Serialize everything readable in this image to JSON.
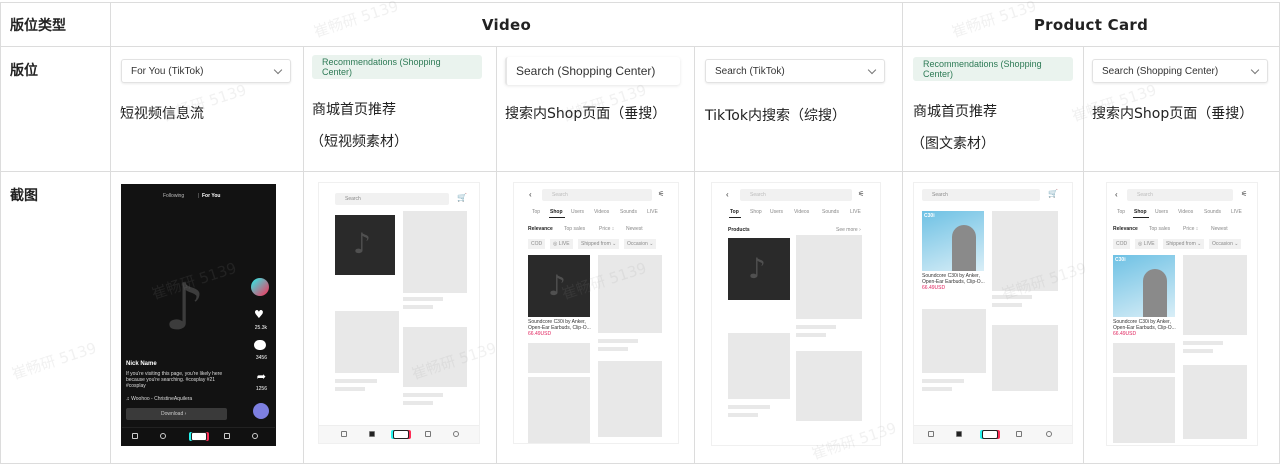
{
  "headers": {
    "type_label": "版位类型",
    "video_group": "Video",
    "product_group": "Product Card"
  },
  "rows": {
    "placement_label": "版位",
    "screenshot_label": "截图"
  },
  "placements": [
    {
      "chip": "For You (TikTok)",
      "name": "短视频信息流",
      "sub": ""
    },
    {
      "chip": "Recommendations (Shopping Center)",
      "name": "商城首页推荐",
      "sub": "（短视频素材）"
    },
    {
      "chip": "Search (Shopping Center)",
      "name": "搜索内Shop页面（垂搜）",
      "sub": ""
    },
    {
      "chip": "Search (TikTok)",
      "name": "TikTok内搜索（综搜）",
      "sub": ""
    },
    {
      "chip": "Recommendations (Shopping Center)",
      "name": "商城首页推荐",
      "sub": "（图文素材）"
    },
    {
      "chip": "Search (Shopping Center)",
      "name": "搜索内Shop页面（垂搜）",
      "sub": ""
    }
  ],
  "phone_foryou": {
    "following": "Following",
    "for_you": "For You",
    "likes": "25.3k",
    "comments": "3456",
    "shares": "1256",
    "name": "Nick Name",
    "caption": "If you're visiting this page, you're likely here because you're searching. #cosplay #21 #cosplay",
    "music": "♫ Woohoo - ChristineAquilera",
    "download": "Download ›"
  },
  "phone_common": {
    "search": "Search",
    "tabs_shop": [
      "Top",
      "Shop",
      "Users",
      "Videos",
      "Sounds",
      "LIVE"
    ],
    "filters": [
      "Relevance",
      "Top sales",
      "Price ↕",
      "Newest"
    ],
    "chips": [
      "COD",
      "◎ LIVE",
      "Shipped from ⌄",
      "Occasion ⌄"
    ],
    "product_title": "Soundcore C30i by Anker, Open-Ear Earbuds, Clip-O...",
    "price": "66.49USD",
    "products_label": "Products",
    "see_more": "See more ›",
    "c30i": "C30i",
    "nav": [
      "Home",
      "Shop",
      "Inbox",
      "Me"
    ],
    "nav_foryou": [
      "Home",
      "Discover",
      "Inbox",
      "Me"
    ]
  },
  "watermark": "崔畅研 5139"
}
